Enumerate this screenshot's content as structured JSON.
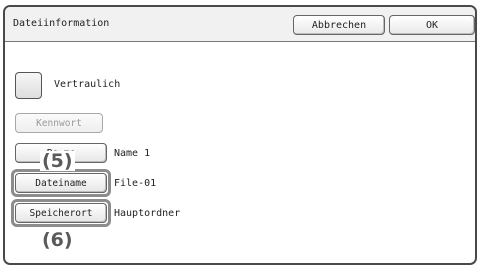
{
  "dialog": {
    "title": "Dateiinformation",
    "cancel_label": "Abbrechen",
    "ok_label": "OK"
  },
  "confidential": {
    "label": "Vertraulich",
    "checked": false
  },
  "password": {
    "label": "Kennwort",
    "enabled": false
  },
  "fields": {
    "user": {
      "button_label": "Be  me",
      "value": "Name 1"
    },
    "filename": {
      "button_label": "Dateiname",
      "value": "File-01"
    },
    "location": {
      "button_label": "Speicherort",
      "value": "Hauptordner"
    }
  },
  "callouts": {
    "five": "(5)",
    "six": "(6)"
  }
}
